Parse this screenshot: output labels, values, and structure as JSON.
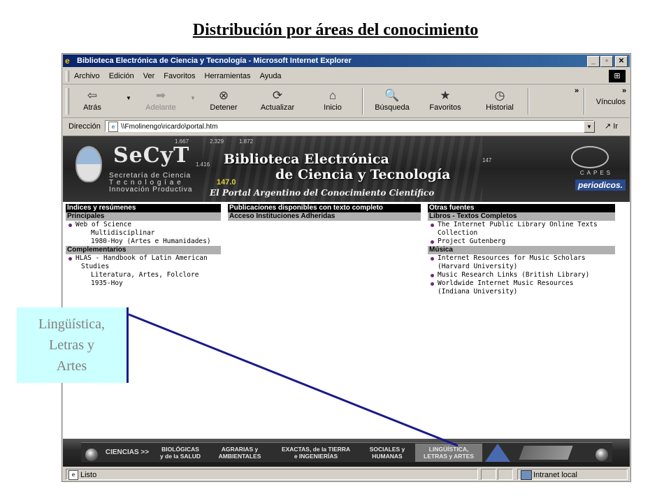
{
  "slide_title": "Distribución por áreas del conocimiento",
  "window": {
    "title": "Biblioteca Electrónica de Ciencia y Tecnología - Microsoft Internet Explorer",
    "controls": {
      "minimize": "_",
      "maximize": "▫",
      "close": "✕"
    }
  },
  "menubar": {
    "items": [
      "Archivo",
      "Edición",
      "Ver",
      "Favoritos",
      "Herramientas",
      "Ayuda"
    ]
  },
  "toolbar": {
    "buttons": [
      {
        "label": "Atrás",
        "icon": "back-arrow-icon",
        "glyph": "⇦"
      },
      {
        "label": "Adelante",
        "icon": "forward-arrow-icon",
        "glyph": "➡",
        "disabled": true
      },
      {
        "label": "Detener",
        "icon": "stop-icon",
        "glyph": "⊗"
      },
      {
        "label": "Actualizar",
        "icon": "refresh-icon",
        "glyph": "⟳"
      },
      {
        "label": "Inicio",
        "icon": "home-icon",
        "glyph": "⌂"
      },
      {
        "label": "Búsqueda",
        "icon": "search-icon",
        "glyph": "🔍"
      },
      {
        "label": "Favoritos",
        "icon": "favorites-icon",
        "glyph": "★"
      },
      {
        "label": "Historial",
        "icon": "history-icon",
        "glyph": "◷"
      }
    ],
    "chevron": "»",
    "links_label": "Vínculos"
  },
  "addressbar": {
    "label": "Dirección",
    "value": "\\\\Fmolinengo\\ricardo\\portal.htm",
    "go_label": "Ir"
  },
  "banner": {
    "org": "SeCyT",
    "org_sub": [
      "Secretaría de Ciencia",
      "T e c n o l o g í a   e",
      "Innovación Productiva"
    ],
    "title_l1": "Biblioteca Electrónica",
    "title_l2": "de Ciencia y Tecnología",
    "subtitle": "El Portal Argentino del Conocimiento Científico",
    "numbers": [
      "1.667",
      "2.329",
      "1.872",
      "1.416",
      "147.0",
      "147"
    ],
    "partner": "CAPES",
    "partner_badge": "periodicos."
  },
  "columns": {
    "left": {
      "header": "Índices y resúmenes",
      "sub1": "Principales",
      "e1": {
        "title": "Web of Science",
        "l2": "Multidisciplinar",
        "l3": "1980-Hoy (Artes e Humanidades)"
      },
      "sub2": "Complementarios",
      "e2": {
        "title": "HLAS - Handbook of Latin American",
        "l2": "Studies",
        "l3": "Literatura, Artes, Folclore",
        "l4": "1935-Hoy"
      }
    },
    "middle": {
      "header": "Publicaciones disponibles con texto completo",
      "sub1": "Acceso Instituciones Adheridas"
    },
    "right": {
      "header": "Otras fuentes",
      "sub1": "Libros - Textos Completos",
      "e1": {
        "title": "The Internet Public Library Online Texts",
        "l2": "Collection"
      },
      "e2": {
        "title": "Project Gutenberg"
      },
      "sub2": "Música",
      "e3": {
        "title": "Internet Resources for Music Scholars",
        "l2": "(Harvard University)"
      },
      "e4": {
        "title": "Music Research Links (British Library)"
      },
      "e5": {
        "title": "Worldwide Internet Music Resources",
        "l2": "(Indiana University)"
      }
    }
  },
  "bottom_nav": {
    "ciencias": "CIENCIAS >>",
    "items": [
      {
        "l1": "BIOLÓGICAS",
        "l2": "y de la SALUD"
      },
      {
        "l1": "AGRARIAS y",
        "l2": "AMBIENTALES"
      },
      {
        "l1": "EXACTAS, de la TIERRA",
        "l2": "e INGENIERÍAS"
      },
      {
        "l1": "SOCIALES y",
        "l2": "HUMANAS"
      },
      {
        "l1": "LINGÜÍSTICA,",
        "l2": "LETRAS y ARTES"
      }
    ]
  },
  "statusbar": {
    "status": "Listo",
    "zone": "Intranet local"
  },
  "callout": {
    "l1": "Lingüística,",
    "l2": "Letras y",
    "l3": "Artes"
  },
  "colors": {
    "callout_bg": "#ccffff",
    "pointer": "#1a1a8c",
    "bullet": "#6a2a7a"
  }
}
